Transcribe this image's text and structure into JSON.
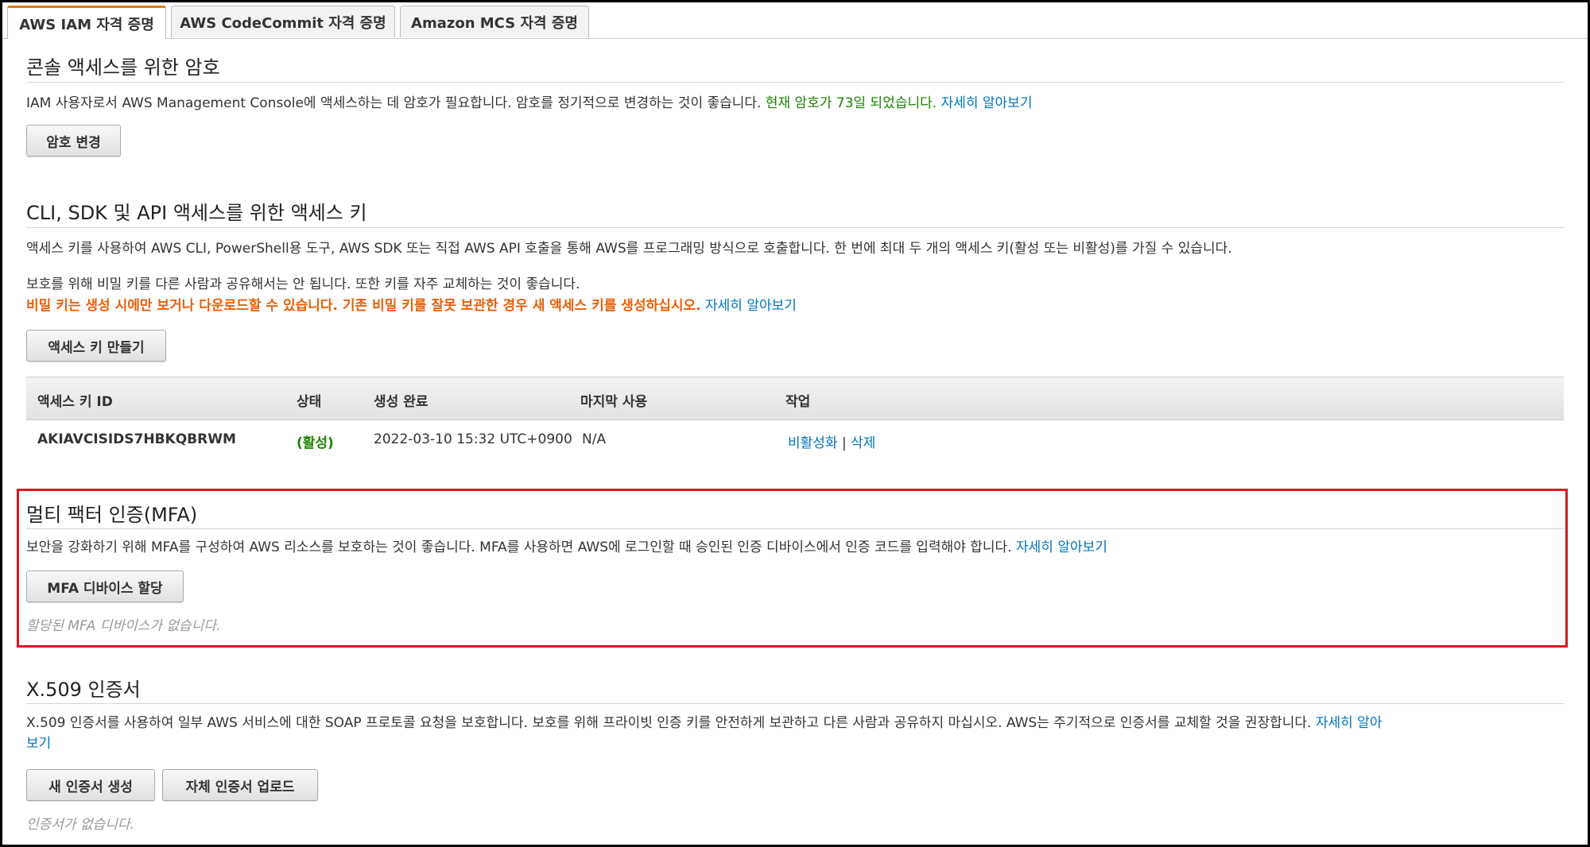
{
  "tabs": [
    {
      "label": "AWS IAM 자격 증명"
    },
    {
      "label": "AWS CodeCommit 자격 증명"
    },
    {
      "label": "Amazon MCS 자격 증명"
    }
  ],
  "console": {
    "title": "콘솔 액세스를 위한 암호",
    "description": "IAM 사용자로서 AWS Management Console에 액세스하는 데 암호가 필요합니다. 암호를 정기적으로 변경하는 것이 좋습니다.",
    "status": "현재 암호가 73일 되었습니다.",
    "learn_more": "자세히 알아보기",
    "button": "암호 변경"
  },
  "access_keys": {
    "title": "CLI, SDK 및 API 액세스를 위한 액세스 키",
    "description": "액세스 키를 사용하여 AWS CLI, PowerShell용 도구, AWS SDK 또는 직접 AWS API 호출을 통해 AWS를 프로그래밍 방식으로 호출합니다. 한 번에 최대 두 개의 액세스 키(활성 또는 비활성)를 가질 수 있습니다.",
    "security_note": "보호를 위해 비밀 키를 다른 사람과 공유해서는 안 됩니다. 또한 키를 자주 교체하는 것이 좋습니다.",
    "warning": "비밀 키는 생성 시에만 보거나 다운로드할 수 있습니다. 기존 비밀 키를 잘못 보관한 경우 새 액세스 키를 생성하십시오.",
    "learn_more": "자세히 알아보기",
    "button": "액세스 키 만들기",
    "columns": [
      "액세스 키 ID",
      "상태",
      "생성 완료",
      "마지막 사용",
      "작업"
    ],
    "rows": [
      {
        "key_id": "AKIAVCISIDS7HBKQBRWM",
        "status": "(활성)",
        "created": "2022-03-10 15:32 UTC+0900",
        "last_used": "N/A",
        "action_deactivate": "비활성화",
        "separator": "|",
        "action_delete": "삭제"
      }
    ]
  },
  "mfa": {
    "title": "멀티 팩터 인증(MFA)",
    "description": "보안을 강화하기 위해 MFA를 구성하여 AWS 리소스를 보호하는 것이 좋습니다. MFA를 사용하면 AWS에 로그인할 때 승인된 인증 디바이스에서 인증 코드를 입력해야 합니다.",
    "learn_more": "자세히 알아보기",
    "button": "MFA 디바이스 할당",
    "empty": "할당된 MFA 디바이스가 없습니다."
  },
  "x509": {
    "title": "X.509 인증서",
    "description": "X.509 인증서를 사용하여 일부 AWS 서비스에 대한 SOAP 프로토콜 요청을 보호합니다. 보호를 위해 프라이빗 인증 키를 안전하게 보관하고 다른 사람과 공유하지 마십시오. AWS는 주기적으로 인증서를 교체할 것을 권장합니다.",
    "learn_more_line1": "자세히 알아",
    "learn_more_line2": "보기",
    "button_create": "새 인증서 생성",
    "button_upload": "자체 인증서 업로드",
    "empty": "인증서가 없습니다."
  },
  "colors": {
    "accent_tab": "#e47911",
    "link": "#0073bb",
    "green": "#1d8102",
    "warning": "#eb5f07",
    "highlight_border": "#e0141e"
  }
}
